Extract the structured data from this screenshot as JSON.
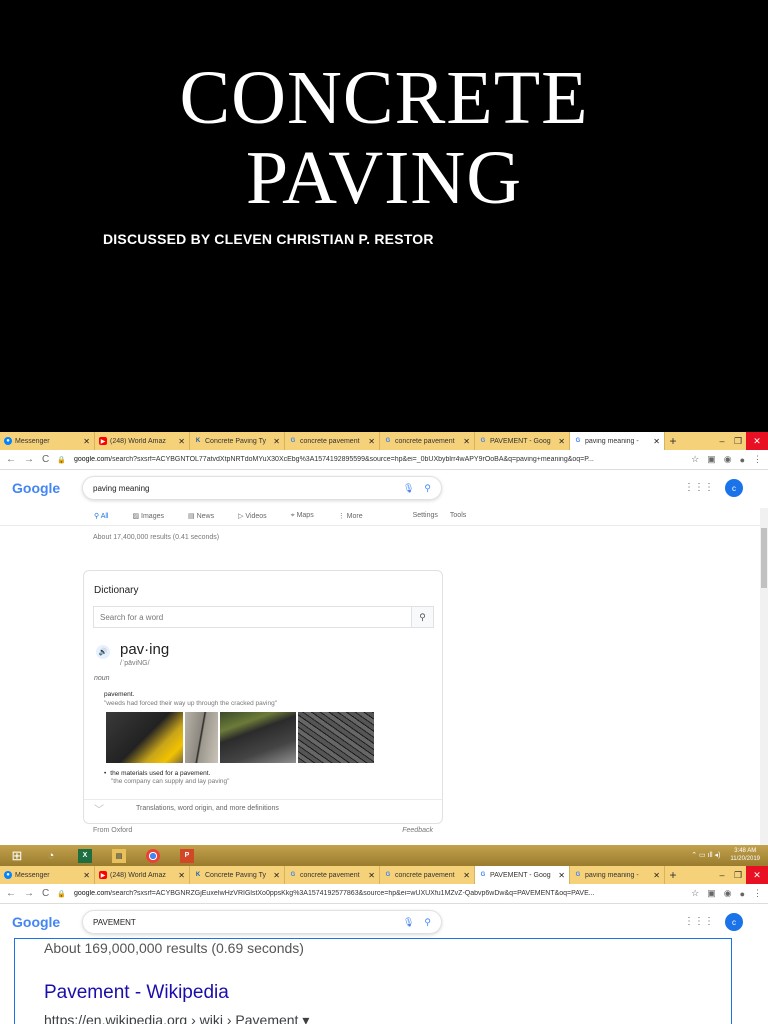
{
  "slide": {
    "title_line1": "CONCRETE",
    "title_line2": "PAVING",
    "subtitle": "DISCUSSED BY CLEVEN CHRISTIAN P. RESTOR"
  },
  "colors": {
    "background": "#000000",
    "tabbar": "#f5d17a",
    "google_blue": "#4285f4",
    "link": "#1a0dab"
  },
  "browser1": {
    "tabs": [
      {
        "label": "Messenger",
        "icon": "messenger-icon"
      },
      {
        "label": "(248) World Amaz",
        "icon": "youtube-icon"
      },
      {
        "label": "Concrete Paving Ty",
        "icon": "ka-icon"
      },
      {
        "label": "concrete pavement",
        "icon": "google-icon"
      },
      {
        "label": "concrete pavement",
        "icon": "google-icon"
      },
      {
        "label": "PAVEMENT - Goog",
        "icon": "google-icon"
      },
      {
        "label": "paving meaning -",
        "icon": "google-icon",
        "active": true
      }
    ],
    "url_host": "google.com",
    "url_path": "/search?sxsrf=ACYBGNTOL77atvdXtpNRTdoMYuX30XcEbg%3A1574192895599&source=hp&ei=_0bUXbyblrr4wAPY9rOoBA&q=paving+meaning&oq=P...",
    "logo": "Google",
    "query": "paving meaning",
    "avatar_letter": "c",
    "search_tabs": [
      "All",
      "Images",
      "News",
      "Videos",
      "Maps",
      "More"
    ],
    "search_tools": [
      "Settings",
      "Tools"
    ],
    "stats": "About 17,400,000 results (0.41 seconds)",
    "dictionary": {
      "heading": "Dictionary",
      "search_placeholder": "Search for a word",
      "word": "pav·ing",
      "phonetic": "/ˈpāviNG/",
      "part_of_speech": "noun",
      "def1": "pavement.",
      "ex1": "\"weeds had forced their way up through the cracked paving\"",
      "def2": "the materials used for a pavement.",
      "ex2": "\"the company can supply and lay paving\"",
      "more": "Translations, word origin, and more definitions",
      "source": "From Oxford",
      "feedback": "Feedback"
    }
  },
  "taskbar": {
    "apps": [
      "windows-icon",
      "explorer-icon",
      "excel-icon",
      "files-icon",
      "chrome-icon",
      "powerpoint-icon"
    ],
    "time": "3:48 AM",
    "date": "11/20/2019"
  },
  "browser2": {
    "tabs": [
      {
        "label": "Messenger",
        "icon": "messenger-icon"
      },
      {
        "label": "(248) World Amaz",
        "icon": "youtube-icon"
      },
      {
        "label": "Concrete Paving Ty",
        "icon": "ka-icon"
      },
      {
        "label": "concrete pavement",
        "icon": "google-icon"
      },
      {
        "label": "concrete pavement",
        "icon": "google-icon"
      },
      {
        "label": "PAVEMENT - Goog",
        "icon": "google-icon",
        "active": true
      },
      {
        "label": "paving meaning -",
        "icon": "google-icon"
      }
    ],
    "url_host": "google.com",
    "url_path": "/search?sxsrf=ACYBGNRZGjEuxeIwHzVRIGlstXo0ppsKkg%3A1574192577863&source=hp&ei=wUXUXfu1MZvZ-Qabvp6wDw&q=PAVEMENT&oq=PAVE...",
    "logo": "Google",
    "query": "PAVEMENT",
    "avatar_letter": "c",
    "stats": "About 169,000,000 results (0.69 seconds)",
    "result_title": "Pavement - Wikipedia",
    "result_url": "https://en.wikipedia.org › wiki › Pavement ▾"
  }
}
